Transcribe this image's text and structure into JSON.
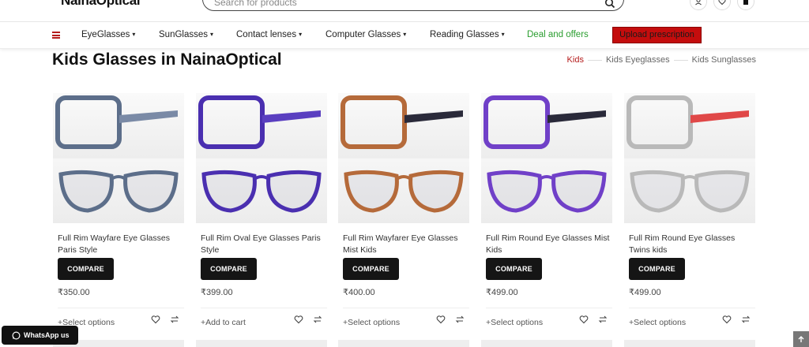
{
  "header": {
    "logo": "NainaOptical",
    "search_placeholder": "Search for products"
  },
  "nav": {
    "items": [
      "EyeGlasses",
      "SunGlasses",
      "Contact lenses",
      "Computer Glasses",
      "Reading Glasses"
    ],
    "deal": "Deal and offers",
    "upload": "Upload prescription"
  },
  "page": {
    "title": "Kids Glasses in NainaOptical",
    "filters": [
      "Kids",
      "Kids Eyeglasses",
      "Kids Sunglasses"
    ]
  },
  "products": [
    {
      "name": "Full Rim Wayfare Eye Glasses Paris Style",
      "price": "₹350.00",
      "action": "Select options",
      "compare": "COMPARE",
      "frame_color": "#5c6e8a",
      "temple_color": "#7a8aa6"
    },
    {
      "name": "Full Rim Oval Eye Glasses Paris Style",
      "price": "₹399.00",
      "action": "Add to cart",
      "compare": "COMPARE",
      "frame_color": "#4a2fb0",
      "temple_color": "#5a3fc0"
    },
    {
      "name": "Full Rim Wayfarer Eye Glasses Mist Kids",
      "price": "₹400.00",
      "action": "Select options",
      "compare": "COMPARE",
      "frame_color": "#b56a3a",
      "temple_color": "#2a2a3a"
    },
    {
      "name": "Full Rim Round Eye Glasses Mist Kids",
      "price": "₹499.00",
      "action": "Select options",
      "compare": "COMPARE",
      "frame_color": "#7040c8",
      "temple_color": "#2a2a3a"
    },
    {
      "name": "Full Rim Round Eye Glasses Twins kids",
      "price": "₹499.00",
      "action": "Select options",
      "compare": "COMPARE",
      "frame_color": "#b9b9b9",
      "temple_color": "#e04848"
    }
  ],
  "whatsapp": "WhatsApp us",
  "colors": {
    "accent": "#b51c1c",
    "deal": "#2a9d2f",
    "button": "#151515"
  }
}
